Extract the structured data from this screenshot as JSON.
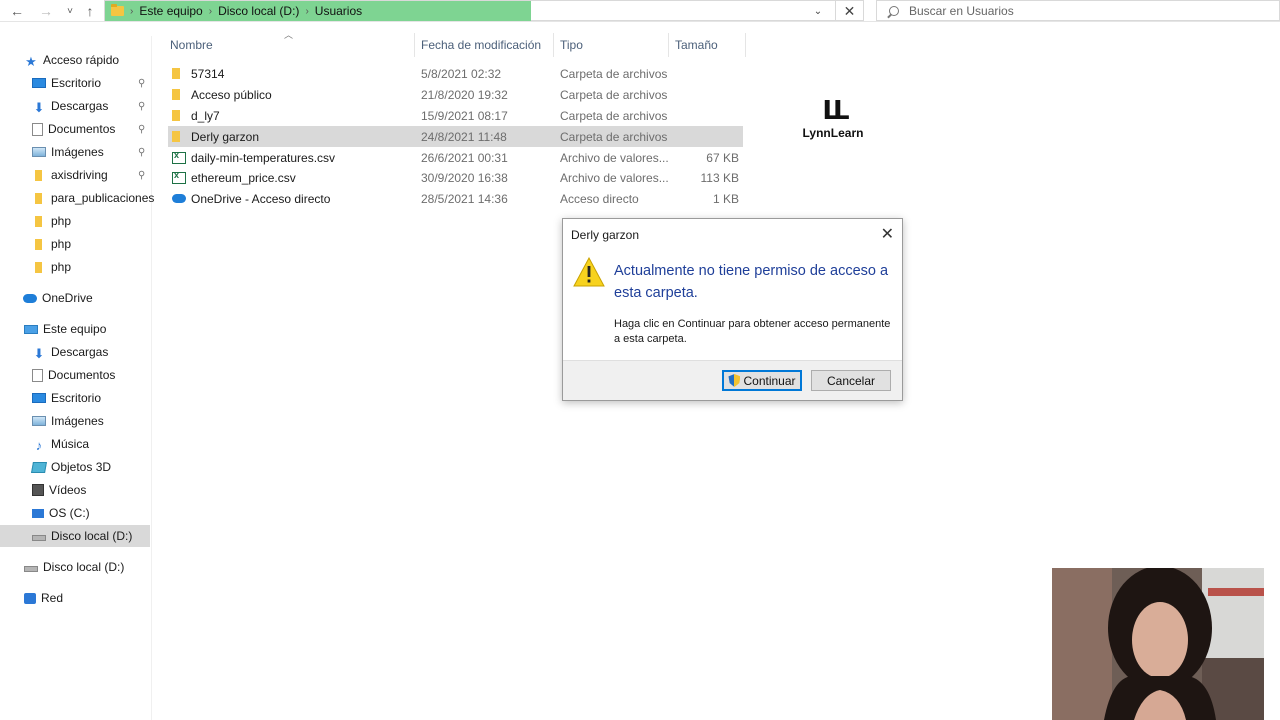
{
  "nav": {
    "back": "←",
    "forward": "→",
    "recent": "˅",
    "up": "↑"
  },
  "address": {
    "crumbs": [
      "Este equipo",
      "Disco local (D:)",
      "Usuarios"
    ],
    "separator": "›",
    "dropdown": "⌄",
    "refresh": "✕"
  },
  "search": {
    "placeholder": "Buscar en Usuarios"
  },
  "sidebar": {
    "items": [
      {
        "label": "Acceso rápido",
        "icon": "star-icon"
      },
      {
        "label": "Escritorio",
        "icon": "desktop-icon",
        "pinned": true
      },
      {
        "label": "Descargas",
        "icon": "download-icon",
        "pinned": true
      },
      {
        "label": "Documentos",
        "icon": "documents-icon",
        "pinned": true
      },
      {
        "label": "Imágenes",
        "icon": "pictures-icon",
        "pinned": true
      },
      {
        "label": "axisdriving",
        "icon": "folder-icon",
        "pinned": true
      },
      {
        "label": "para_publicaciones",
        "icon": "folder-icon"
      },
      {
        "label": "php",
        "icon": "folder-icon"
      },
      {
        "label": "php",
        "icon": "folder-icon"
      },
      {
        "label": "php",
        "icon": "folder-icon"
      },
      {
        "label": "OneDrive",
        "icon": "onedrive-icon"
      },
      {
        "label": "Este equipo",
        "icon": "computer-icon"
      },
      {
        "label": "Descargas",
        "icon": "download-icon"
      },
      {
        "label": "Documentos",
        "icon": "documents-icon"
      },
      {
        "label": "Escritorio",
        "icon": "desktop-icon"
      },
      {
        "label": "Imágenes",
        "icon": "pictures-icon"
      },
      {
        "label": "Música",
        "icon": "music-icon"
      },
      {
        "label": "Objetos 3D",
        "icon": "objects-3d-icon"
      },
      {
        "label": "Vídeos",
        "icon": "videos-icon"
      },
      {
        "label": "OS (C:)",
        "icon": "os-drive-icon"
      },
      {
        "label": "Disco local (D:)",
        "icon": "drive-icon",
        "selected": true
      },
      {
        "label": "Disco local (D:)",
        "icon": "drive-icon"
      },
      {
        "label": "Red",
        "icon": "network-icon"
      }
    ],
    "pin_glyph": "📌"
  },
  "columns": {
    "name": "Nombre",
    "modified": "Fecha de modificación",
    "type": "Tipo",
    "size": "Tamaño"
  },
  "files": [
    {
      "name": "57314",
      "modified": "5/8/2021 02:32",
      "type": "Carpeta de archivos",
      "size": "",
      "kind": "folder"
    },
    {
      "name": "Acceso público",
      "modified": "21/8/2020 19:32",
      "type": "Carpeta de archivos",
      "size": "",
      "kind": "folder"
    },
    {
      "name": "d_ly7",
      "modified": "15/9/2021 08:17",
      "type": "Carpeta de archivos",
      "size": "",
      "kind": "folder"
    },
    {
      "name": "Derly garzon",
      "modified": "24/8/2021 11:48",
      "type": "Carpeta de archivos",
      "size": "",
      "kind": "folder",
      "selected": true
    },
    {
      "name": "daily-min-temperatures.csv",
      "modified": "26/6/2021 00:31",
      "type": "Archivo de valores...",
      "size": "67 KB",
      "kind": "csv"
    },
    {
      "name": "ethereum_price.csv",
      "modified": "30/9/2020 16:38",
      "type": "Archivo de valores...",
      "size": "113 KB",
      "kind": "csv"
    },
    {
      "name": "OneDrive - Acceso directo",
      "modified": "28/5/2021 14:36",
      "type": "Acceso directo",
      "size": "1 KB",
      "kind": "shortcut"
    }
  ],
  "logo": {
    "text": "LynnLearn"
  },
  "dialog": {
    "title": "Derly garzon",
    "close": "✕",
    "heading": "Actualmente no tiene permiso de acceso a esta carpeta.",
    "body": "Haga clic en Continuar para obtener acceso permanente a esta carpeta.",
    "continue_label": "Continuar",
    "cancel_label": "Cancelar"
  },
  "colors": {
    "address_highlight": "#7ed492",
    "selection": "#d9d9d9",
    "dialog_heading": "#1f3f99",
    "accent": "#0078d7"
  }
}
